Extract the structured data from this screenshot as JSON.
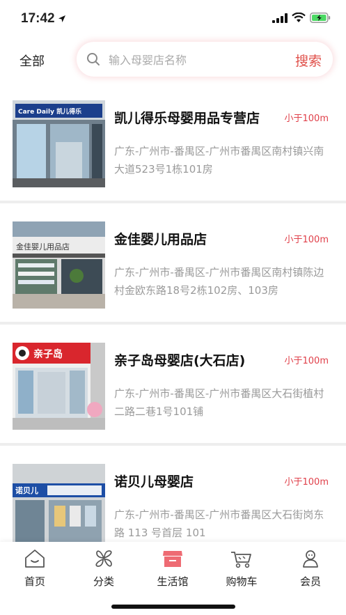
{
  "status": {
    "time": "17:42"
  },
  "top": {
    "filter_label": "全部",
    "search_placeholder": "输入母婴店名称",
    "search_button": "搜索"
  },
  "stores": [
    {
      "name": "凯儿得乐母婴用品专营店",
      "distance": "小于100m",
      "address": "广东-广州市-番禺区-广州市番禺区南村镇兴南大道523号1栋101房",
      "sign_text": "Care Daily 凯儿得乐"
    },
    {
      "name": "金佳婴儿用品店",
      "distance": "小于100m",
      "address": "广东-广州市-番禺区-广州市番禺区南村镇陈边村金欧东路18号2栋102房、103房",
      "sign_text": "金佳婴儿用品店"
    },
    {
      "name": "亲子岛母婴店(大石店)",
      "distance": "小于100m",
      "address": "广东-广州市-番禺区-广州市番禺区大石街植村二路二巷1号101铺",
      "sign_text": "亲子岛"
    },
    {
      "name": "诺贝儿母婴店",
      "distance": "小于100m",
      "address": "广东-广州市-番禺区-广州市番禺区大石街岗东路 113 号首层 101",
      "sign_text": "诺贝儿"
    }
  ],
  "tabs": [
    {
      "label": "首页",
      "icon": "home-icon"
    },
    {
      "label": "分类",
      "icon": "category-icon"
    },
    {
      "label": "生活馆",
      "icon": "store-icon",
      "active": true
    },
    {
      "label": "购物车",
      "icon": "cart-icon"
    },
    {
      "label": "会员",
      "icon": "member-icon"
    }
  ],
  "colors": {
    "accent": "#e0504a",
    "distance": "#e0404a",
    "address": "#9a9a9a",
    "tab_active": "#ee6b73"
  }
}
